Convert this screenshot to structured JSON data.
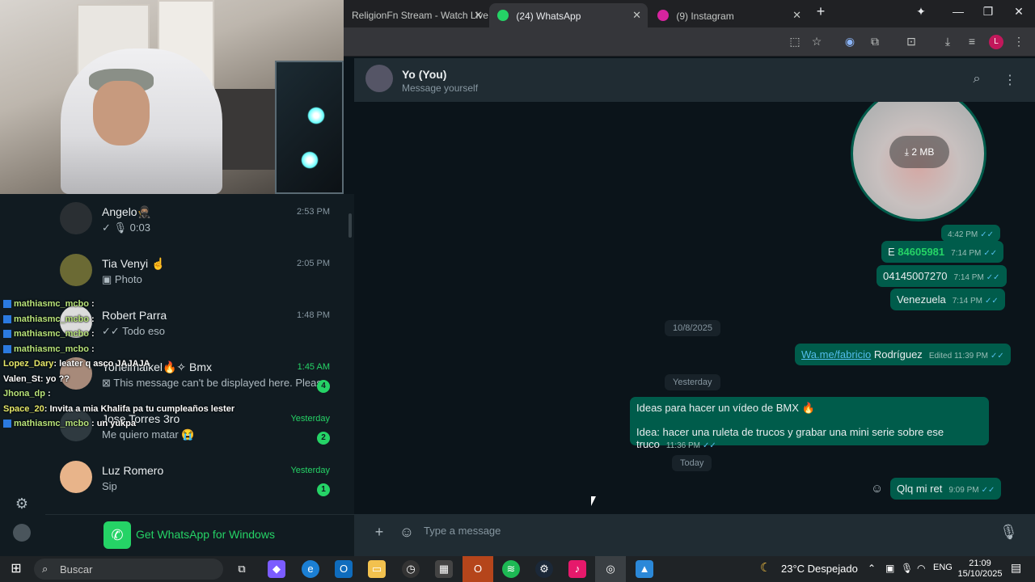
{
  "browser": {
    "tabs": [
      {
        "label": "ReligionFn Stream - Watch Live",
        "icon_color": "#202124"
      },
      {
        "label": "(24) WhatsApp",
        "icon_color": "#25d366"
      },
      {
        "label": "(9) Instagram",
        "icon_color": "#d6249f"
      }
    ],
    "new_tab_icon": "plus-icon"
  },
  "chat_list": [
    {
      "name": "Angelo🥷🏽",
      "preview": "✓ 🎙 0:03",
      "time": "2:53 PM",
      "unread": "",
      "time_green": false
    },
    {
      "name": "Tia Venyi ☝",
      "preview": "▣ Photo",
      "time": "2:05 PM",
      "unread": "",
      "time_green": false
    },
    {
      "name": "Robert Parra",
      "preview": "✓✓ Todo eso",
      "time": "1:48 PM",
      "unread": "",
      "time_green": false
    },
    {
      "name": "Yohelmaikel🔥✧ Bmx",
      "preview": "⊠ This message can't be displayed here. Please ...",
      "time": "1:45 AM",
      "unread": "4",
      "time_green": true
    },
    {
      "name": "Jose Torres 3ro",
      "preview": "Me quiero matar 😭",
      "time": "Yesterday",
      "unread": "2",
      "time_green": true
    },
    {
      "name": "Luz Romero",
      "preview": "Sip",
      "time": "Yesterday",
      "unread": "1",
      "time_green": true
    }
  ],
  "get_whatsapp": "Get WhatsApp for Windows",
  "twitch_chat": [
    {
      "user": "mathiasmc_mcbo",
      "msg": ":",
      "color": "g"
    },
    {
      "user": "mathiasmc_mcbo",
      "msg": ":",
      "color": "g"
    },
    {
      "user": "mathiasmc_mcbo",
      "msg": ":",
      "color": "g"
    },
    {
      "user": "mathiasmc_mcbo",
      "msg": ":",
      "color": "g"
    },
    {
      "user": "Lopez_Dary",
      "msg": ": leater q asco JAJAJA",
      "color": "y"
    },
    {
      "user": "Valen_St",
      "msg": ": yo ??",
      "color": "w"
    },
    {
      "user": "Jhona_dp",
      "msg": ":",
      "color": "g"
    },
    {
      "user": "Space_20",
      "msg": ": Invita a mia Khalifa pa tu cumpleaños lester",
      "color": "o"
    },
    {
      "user": "mathiasmc_mcbo",
      "msg": ": un yukpa",
      "color": "g"
    }
  ],
  "header": {
    "name": "Yo (You)",
    "subtitle": "Message yourself"
  },
  "messages": {
    "video_size": "2 MB",
    "video_time": "4:42 PM",
    "m1_prefix": "E ",
    "m1_number": "84605981",
    "m1_time": "7:14 PM",
    "m2_text": "04145007270",
    "m2_time": "7:14 PM",
    "m3_text": "Venezuela",
    "m3_time": "7:14 PM",
    "date1": "10/8/2025",
    "m4_link": "Wa.me/fabricio",
    "m4_text": " Rodríguez",
    "m4_time": "Edited 11:39 PM",
    "date2": "Yesterday",
    "m5_line1": "Ideas para hacer un vídeo de BMX 🔥",
    "m5_line2": "Idea: hacer una ruleta de trucos y grabar una mini serie sobre ese truco",
    "m5_time": "11:36 PM",
    "date3": "Today",
    "m6_text": "Qlq mi ret",
    "m6_time": "9:09 PM"
  },
  "compose": {
    "placeholder": "Type a message"
  },
  "taskbar": {
    "search": "Buscar",
    "weather": "23°C Despejado",
    "lang": "ENG",
    "time": "21:09",
    "date": "15/10/2025"
  }
}
